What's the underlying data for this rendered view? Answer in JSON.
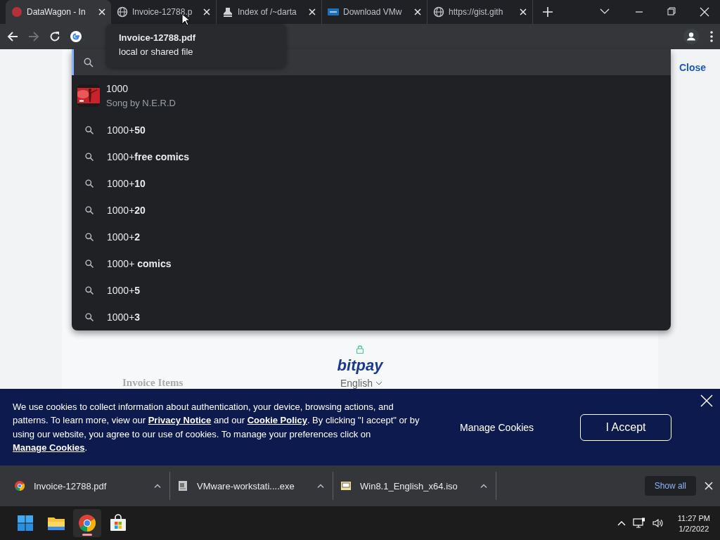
{
  "tabs": [
    {
      "title": "DataWagon - In",
      "kind": "red-circle",
      "selected": true
    },
    {
      "title": "Invoice-12788.p",
      "kind": "globe",
      "selected": false
    },
    {
      "title": "Index of /~darta",
      "kind": "stamp",
      "selected": false
    },
    {
      "title": "Download VMw",
      "kind": "vm",
      "selected": false
    },
    {
      "title": "https://gist.gith",
      "kind": "globe",
      "selected": false
    }
  ],
  "tooltip": {
    "title": "Invoice-12788.pdf",
    "subtitle": "local or shared file"
  },
  "toolbar": {
    "forward_disabled": true
  },
  "omnibox": {
    "suggestions": [
      {
        "kind": "entity",
        "text": "1000",
        "subtitle": "Song by N.E.R.D"
      },
      {
        "kind": "search",
        "text": "1000+**50**"
      },
      {
        "kind": "search",
        "text": "1000+**free comics**"
      },
      {
        "kind": "search",
        "text": "1000+**10**"
      },
      {
        "kind": "search",
        "text": "1000+**20**"
      },
      {
        "kind": "search",
        "text": "1000+**2**"
      },
      {
        "kind": "search",
        "text": "1000+ **comics**"
      },
      {
        "kind": "search",
        "text": "1000+**5**"
      },
      {
        "kind": "search",
        "text": "1000+**3**"
      }
    ]
  },
  "page": {
    "close_link": "Close",
    "logo": "bitpay",
    "section_heading": "Invoice Items",
    "language": "English"
  },
  "cookie_banner": {
    "text": "We use cookies to collect information about authentication, your device, browsing actions, and patterns. To learn more, view our **Privacy Notice** and our **Cookie Policy**. By clicking \"I accept\" or by using our website, you agree to our use of cookies. To manage your preferences click on **Manage Cookies**.",
    "manage_button": "Manage Cookies",
    "accept_button": "I Accept"
  },
  "downloads": {
    "items": [
      {
        "name": "Invoice-12788.pdf",
        "kind": "chrome"
      },
      {
        "name": "VMware-workstati....exe",
        "kind": "installer"
      },
      {
        "name": "Win8.1_English_x64.iso",
        "kind": "disc"
      }
    ],
    "show_all": "Show all"
  },
  "taskbar": {
    "apps": [
      {
        "kind": "start",
        "selected": false
      },
      {
        "kind": "explorer",
        "selected": false
      },
      {
        "kind": "chrome",
        "selected": true
      },
      {
        "kind": "store",
        "selected": false
      }
    ],
    "time": "11:27 PM",
    "date": "1/2/2022"
  }
}
